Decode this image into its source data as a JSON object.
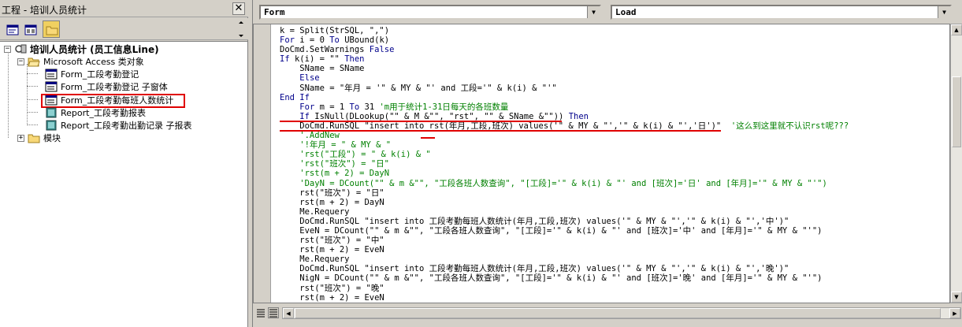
{
  "project_pane": {
    "title": "工程 - 培训人员统计",
    "close_glyph": "✕",
    "tree": {
      "root": "培训人员统计 (员工信息Line)",
      "access_objects": "Microsoft Access 类对象",
      "items": [
        "Form_工段考勤登记",
        "Form_工段考勤登记 子窗体",
        "Form_工段考勤每班人数统计",
        "Report_工段考勤报表",
        "Report_工段考勤出勤记录 子报表"
      ],
      "modules": "模块"
    }
  },
  "code_window": {
    "object_combo": "Form",
    "procedure_combo": "Load",
    "lines": [
      [
        {
          "t": "k = Split(StrSQL, \",\")"
        }
      ],
      [
        {
          "t": "For i = 0 To UBound(k)"
        }
      ],
      [
        {
          "t": "DoCmd.SetWarnings False"
        }
      ],
      [
        {
          "t": "If k(i) = \"\" Then"
        }
      ],
      [
        {
          "t": "    SName = SName"
        }
      ],
      [
        {
          "t": "    Else"
        }
      ],
      [
        {
          "t": "    SName = \"年月 = '\" & MY & \"' and 工段='\" & k(i) & \"'\""
        }
      ],
      [
        {
          "t": "End If"
        }
      ],
      [
        {
          "t": "    For m = 1 To 31 "
        },
        {
          "t": "'m用于统计1-31日每天的各班数量",
          "c": "cm"
        }
      ],
      [
        {
          "t": "    If IsNull(DLookup(\"\" & M &\"\", \"rst\", \"\" & SName &\"\")) Then"
        }
      ],
      [
        {
          "t": "    DoCmd.RunSQL \"insert into rst(年月,工段,班次) values('\" & MY & \"','\" & k(i) & \"','日')\"  "
        },
        {
          "t": "'这么到这里就不认识rst呢???",
          "c": "cm"
        }
      ],
      [
        {
          "t": "    '.AddNew",
          "c": "cm"
        }
      ],
      [
        {
          "t": "    '!年月 = \" & MY & \"",
          "c": "cm"
        }
      ],
      [
        {
          "t": "    'rst(\"工段\") = \" & k(i) & \"",
          "c": "cm"
        }
      ],
      [
        {
          "t": "    'rst(\"班次\") = \"日\"",
          "c": "cm"
        }
      ],
      [
        {
          "t": "    'rst(m + 2) = DayN",
          "c": "cm"
        }
      ],
      [
        {
          "t": "    'DayN = DCount(\"\" & m &\"\", \"工段各班人数查询\", \"[工段]='\" & k(i) & \"' and [班次]='日' and [年月]='\" & MY & \"'\")",
          "c": "cm"
        }
      ],
      [
        {
          "t": "    rst(\"班次\") = \"日\""
        }
      ],
      [
        {
          "t": "    rst(m + 2) = DayN"
        }
      ],
      [
        {
          "t": "    Me.Requery"
        }
      ],
      [
        {
          "t": "    DoCmd.RunSQL \"insert into 工段考勤每班人数统计(年月,工段,班次) values('\" & MY & \"','\" & k(i) & \"','中')\""
        }
      ],
      [
        {
          "t": "    EveN = DCount(\"\" & m &\"\", \"工段各班人数查询\", \"[工段]='\" & k(i) & \"' and [班次]='中' and [年月]='\" & MY & \"'\")"
        }
      ],
      [
        {
          "t": "    rst(\"班次\") = \"中\""
        }
      ],
      [
        {
          "t": "    rst(m + 2) = EveN"
        }
      ],
      [
        {
          "t": "    Me.Requery"
        }
      ],
      [
        {
          "t": "    DoCmd.RunSQL \"insert into 工段考勤每班人数统计(年月,工段,班次) values('\" & MY & \"','\" & k(i) & \"','晚')\""
        }
      ],
      [
        {
          "t": "    NigN = DCount(\"\" & m &\"\", \"工段各班人数查询\", \"[工段]='\" & k(i) & \"' and [班次]='晚' and [年月]='\" & MY & \"'\")"
        }
      ],
      [
        {
          "t": "    rst(\"班次\") = \"晚\""
        }
      ],
      [
        {
          "t": "    rst(m + 2) = EveN"
        }
      ]
    ]
  },
  "colors": {
    "keyword": "#00008b",
    "comment": "#008000",
    "annotation_red": "#e00000"
  }
}
